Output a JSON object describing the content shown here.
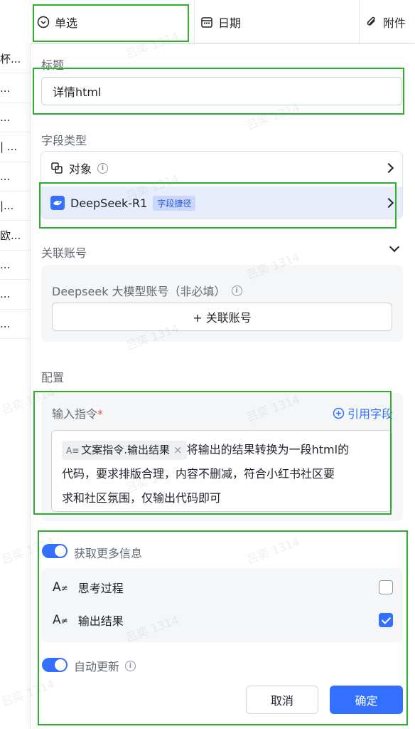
{
  "table": {
    "columns": [
      {
        "label": "单选",
        "icon": "single-select-icon"
      },
      {
        "label": "日期",
        "icon": "calendar-icon"
      },
      {
        "label": "附件",
        "icon": "paperclip-icon"
      }
    ],
    "left_cells": [
      "杯...",
      "...",
      "...",
      "| ...",
      "...",
      "|...",
      "欧...",
      "...",
      "...",
      "..."
    ]
  },
  "watermark": "吕奕 1314",
  "panel": {
    "title_label": "标题",
    "title_value": "详情html",
    "field_type_label": "字段类型",
    "field_type_options": [
      {
        "label": "对象",
        "icon": "object-icon"
      },
      {
        "label": "DeepSeek-R1",
        "icon": "deepseek-logo-icon",
        "tag": "字段捷径"
      }
    ],
    "account_label": "关联账号",
    "account_hint": "Deepseek 大模型账号（非必填）",
    "account_button": "+ 关联账号",
    "config_label": "配置",
    "instruction_label": "输入指令",
    "instruction_required": "*",
    "reference_field": "引用字段",
    "instruction_chip": "文案指令.输出结果",
    "instruction_text_line1": "将输出的结果转换为一段html的",
    "instruction_text_line2": "代码，要求排版合理，内容不删减，符合小红书社区要",
    "instruction_text_line3": "求和社区氛围，仅输出代码即可",
    "more_info_label": "获取更多信息",
    "more_info_on": true,
    "outputs": [
      {
        "label": "思考过程",
        "checked": false
      },
      {
        "label": "输出结果",
        "checked": true
      }
    ],
    "auto_update_label": "自动更新",
    "auto_update_on": true,
    "cancel_label": "取消",
    "confirm_label": "确定"
  },
  "colors": {
    "accent": "#3370ff",
    "highlight_box": "#2eae2e",
    "selected_row_bg": "#e8edfc"
  }
}
